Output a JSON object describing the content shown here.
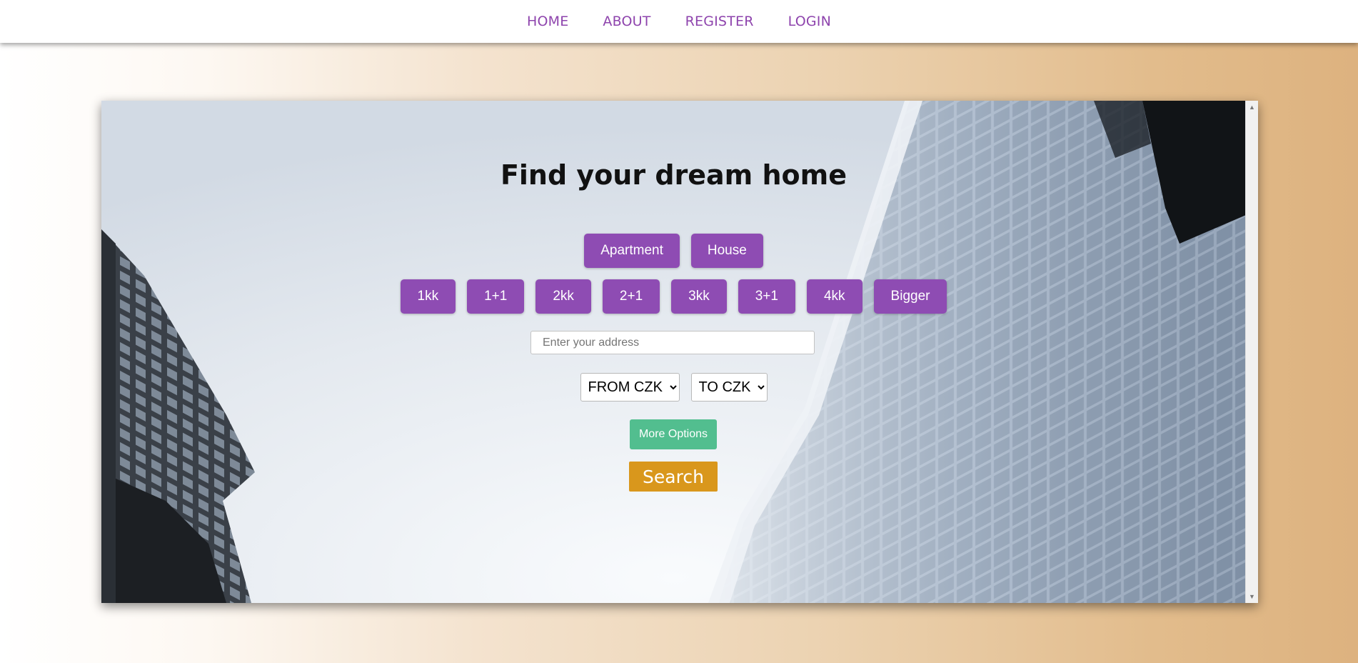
{
  "nav": {
    "links": [
      "HOME",
      "ABOUT",
      "REGISTER",
      "LOGIN"
    ]
  },
  "hero": {
    "title": "Find your dream home",
    "property_types": [
      "Apartment",
      "House"
    ],
    "layouts": [
      "1kk",
      "1+1",
      "2kk",
      "2+1",
      "3kk",
      "3+1",
      "4kk",
      "Bigger"
    ],
    "address_placeholder": "Enter your address",
    "price_from": "FROM CZK",
    "price_to": "TO CZK",
    "more_options_label": "More Options",
    "search_label": "Search"
  },
  "colors": {
    "accent_purple": "#8e4cb3",
    "nav_link": "#8e44ad",
    "more_options_green": "#52be8f",
    "search_orange": "#d9971c"
  },
  "icons": {
    "scroll_up": "chevron-up-icon",
    "scroll_down": "chevron-down-icon"
  }
}
